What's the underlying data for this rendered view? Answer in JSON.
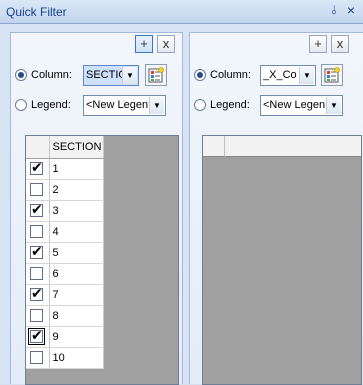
{
  "window": {
    "title": "Quick Filter",
    "pin_glyph": "⫰",
    "close_glyph": "×"
  },
  "panel1": {
    "add_label": "+",
    "remove_label": "x",
    "column_label": "Column:",
    "column_value": "SECTIO",
    "legend_label": "Legend:",
    "legend_value": "<New Legen",
    "header": "SECTION",
    "rows": [
      {
        "value": "1",
        "checked": true
      },
      {
        "value": "2",
        "checked": false
      },
      {
        "value": "3",
        "checked": true
      },
      {
        "value": "4",
        "checked": false
      },
      {
        "value": "5",
        "checked": true
      },
      {
        "value": "6",
        "checked": false
      },
      {
        "value": "7",
        "checked": true
      },
      {
        "value": "8",
        "checked": false
      },
      {
        "value": "9",
        "checked": true
      },
      {
        "value": "10",
        "checked": false
      }
    ]
  },
  "panel2": {
    "add_label": "+",
    "remove_label": "x",
    "column_label": "Column:",
    "column_value": "_X_Co",
    "legend_label": "Legend:",
    "legend_value": "<New Legen"
  },
  "icons": {
    "dropdown": "chevron-down-icon",
    "legend_editor": "legend-palette-icon"
  }
}
